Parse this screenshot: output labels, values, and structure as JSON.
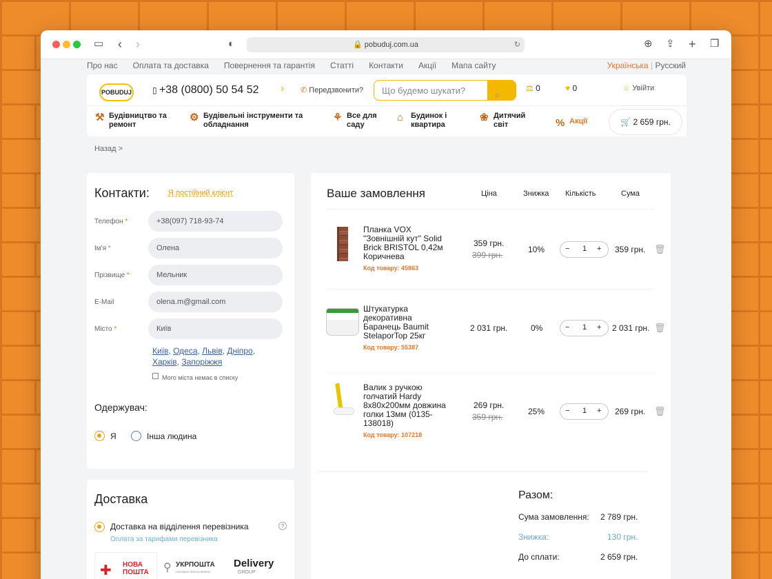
{
  "browser": {
    "url": "pobuduj.com.ua"
  },
  "topnav": {
    "items": [
      "Про нас",
      "Оплата та доставка",
      "Повернення та гарантія",
      "Статті",
      "Контакти",
      "Акції",
      "Мапа сайту"
    ],
    "lang_active": "Українська",
    "lang_other": "Русский"
  },
  "header": {
    "logo": "POBUDUJ",
    "phone": "+38 (0800) 50 54 52",
    "callback": "Передзвонити?",
    "search_placeholder": "Що будемо шукати?",
    "compare_count": "0",
    "fav_count": "0",
    "login": "Увійти"
  },
  "categories": [
    "Будівництво та ремонт",
    "Будівельні інструменти та обладнання",
    "Все для саду",
    "Будинок і квартира",
    "Дитячий світ",
    "Акції"
  ],
  "cart_total": "2 659 грн.",
  "breadcrumb": "Назад",
  "contacts": {
    "title": "Контакти:",
    "regular_link": "Я постійний клієнт",
    "labels": {
      "phone": "Телефон",
      "name": "Ім'я",
      "surname": "Прізвище",
      "email": "E-Mail",
      "city": "Місто"
    },
    "values": {
      "phone": "+38(097) 718-93-74",
      "name": "Олена",
      "surname": "Мельник",
      "email": "olena.m@gmail.com",
      "city": "Київ"
    },
    "cities": [
      "Київ",
      "Одеса",
      "Львів",
      "Дніпро",
      "Харків",
      "Запоріжжя"
    ],
    "no_city": "Мого міста немає в списку",
    "recipient_title": "Одержувач:",
    "recipient_me": "Я",
    "recipient_other": "Інша людина"
  },
  "delivery": {
    "title": "Доставка",
    "option": "Доставка на відділення перевізника",
    "note": "Оплата за тарифами перевізника",
    "carrier1": "НОВА ПОШТА",
    "carrier2": "УКРПОШТА",
    "carrier2_sub": "ГОЛОВНА ПОШТА КРАЇНИ",
    "carrier3": "Delivery",
    "carrier3_sub": "GROUP"
  },
  "order": {
    "title": "Ваше замовлення",
    "cols": {
      "price": "Ціна",
      "discount": "Знижка",
      "qty": "Кількість",
      "sum": "Сума"
    },
    "items": [
      {
        "name_l1": "Планка VOX",
        "name_l2": "\"Зовнішній кут\" Solid",
        "name_l3": "Brick BRISTOL 0,42м",
        "name_l4": "Коричнева",
        "code": "Код товару: 45863",
        "price": "359 грн.",
        "old_price": "399 грн.",
        "discount": "10%",
        "qty": "1",
        "sum": "359 грн."
      },
      {
        "name_l1": "Штукатурка",
        "name_l2": "декоративна",
        "name_l3": "Баранець Baumit",
        "name_l4": "StelaporTop 25кг",
        "code": "Код товару: 55387",
        "price": "2 031 грн.",
        "old_price": "",
        "discount": "0%",
        "qty": "1",
        "sum": "2 031 грн."
      },
      {
        "name_l1": "Валик з ручкою",
        "name_l2": "голчатий Hardy",
        "name_l3": "8x80x200мм довжина",
        "name_l4": "голки 13мм (0135-",
        "name_l5": "138018)",
        "code": "Код товару: 107218",
        "price": "269 грн.",
        "old_price": "359 грн.",
        "discount": "25%",
        "qty": "1",
        "sum": "269 грн."
      }
    ],
    "totals": {
      "title": "Разом:",
      "sum_label": "Сума замовлення:",
      "sum": "2 789 грн.",
      "disc_label": "Знижка:",
      "disc": "130 грн.",
      "pay_label": "До сплати:",
      "pay": "2 659 грн."
    }
  },
  "colors": {
    "accent": "#f5b800",
    "orange": "#e8762a",
    "brick": "#ee8c2c"
  }
}
